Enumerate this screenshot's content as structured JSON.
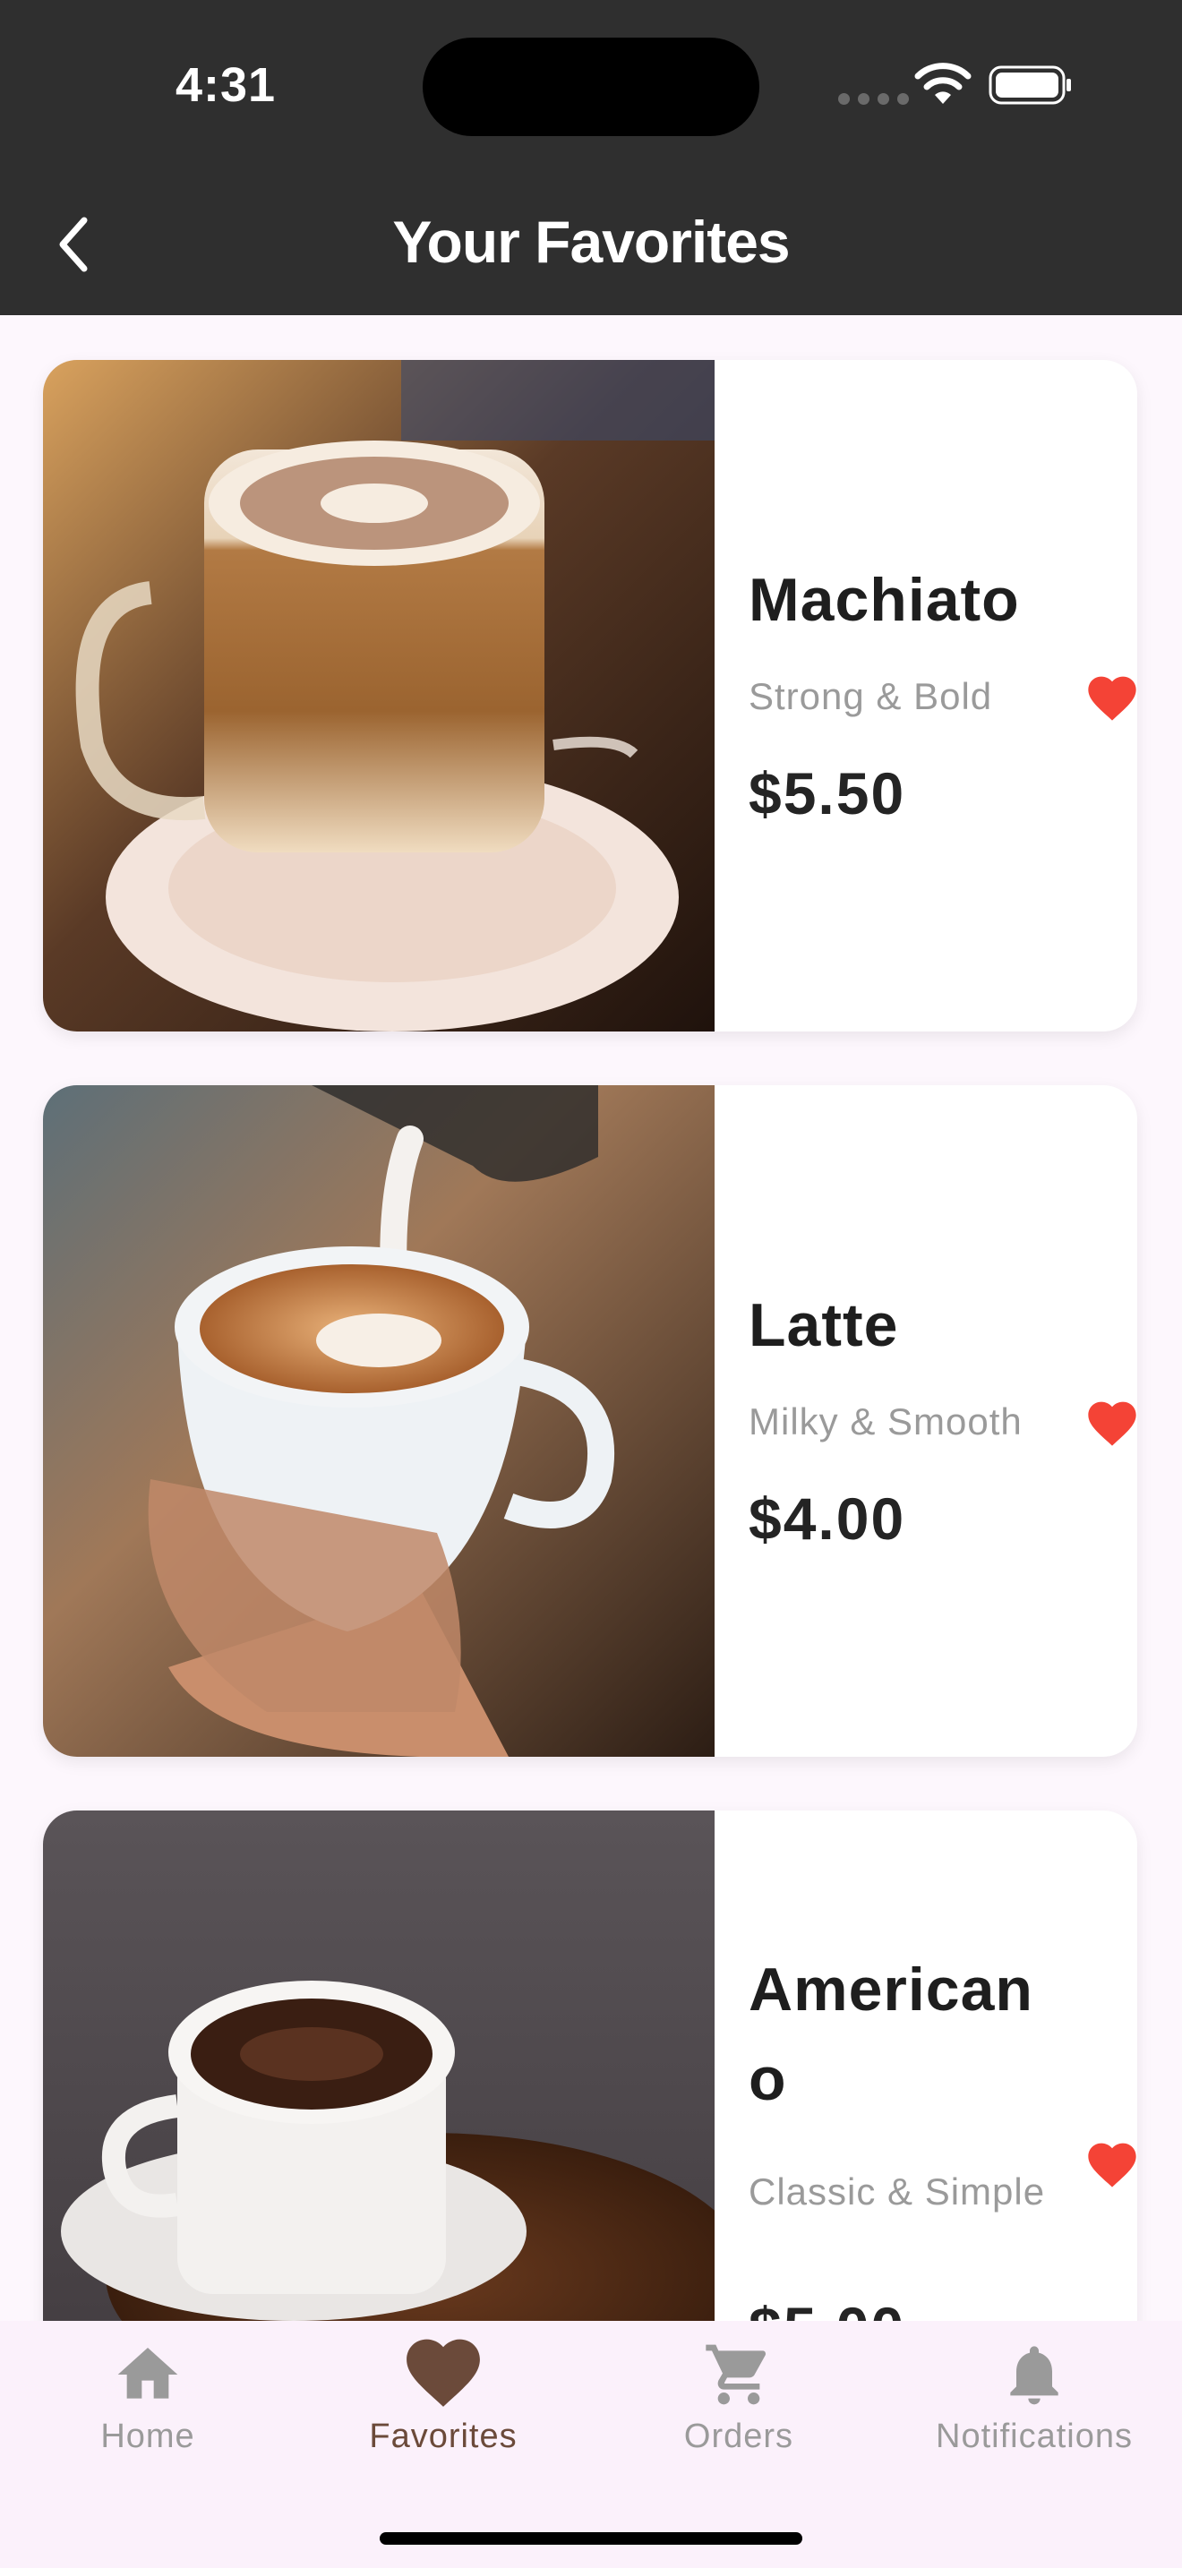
{
  "status_bar": {
    "time": "4:31"
  },
  "app_bar": {
    "title": "Your Favorites",
    "back_icon": "chevron-left-icon"
  },
  "favorites": [
    {
      "name": "Machiato",
      "description": "Strong & Bold",
      "price": "$5.50",
      "favorite": true
    },
    {
      "name": "Latte",
      "description": "Milky & Smooth",
      "price": "$4.00",
      "favorite": true
    },
    {
      "name": "Americano",
      "description": "Classic & Simple",
      "price": "$5.00",
      "favorite": true
    }
  ],
  "bottom_nav": {
    "items": [
      {
        "label": "Home",
        "icon": "home-icon",
        "active": false
      },
      {
        "label": "Favorites",
        "icon": "heart-icon",
        "active": true
      },
      {
        "label": "Orders",
        "icon": "cart-icon",
        "active": false
      },
      {
        "label": "Notifications",
        "icon": "bell-icon",
        "active": false
      }
    ]
  },
  "colors": {
    "app_bar": "#2f2f2f",
    "background": "#fdf7fd",
    "heart": "#f44336",
    "active_nav": "#6b4a3a",
    "inactive_nav": "#9a9a9a"
  }
}
